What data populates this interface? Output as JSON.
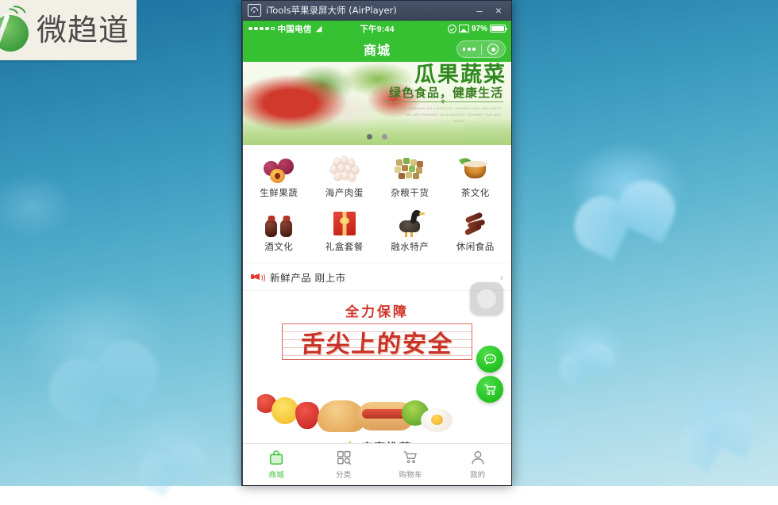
{
  "window": {
    "title": "iTools苹果录屏大师 (AirPlayer)",
    "icon": "airplay-icon",
    "minimize_label": "–",
    "close_label": "×"
  },
  "watermark": {
    "text": "微趋道",
    "icon": "wechat-signal-logo"
  },
  "status_bar": {
    "signal_dots_filled": 4,
    "signal_dots_total": 5,
    "carrier": "中国电信",
    "wifi_icon": "wifi-icon",
    "time": "下午9:44",
    "lock_icon": "rotation-lock-icon",
    "airplay_icon": "airplay-mirror-icon",
    "battery_percent": "97%",
    "battery_level": 97
  },
  "nav_bar": {
    "title": "商城",
    "capsule": {
      "menu_icon": "more-dots-icon",
      "target_icon": "target-circle-icon"
    }
  },
  "hero": {
    "headline": "瓜果蔬菜",
    "subtitle": "绿色食品，健康生活",
    "fine_line1": "WE ARE RUNNING ON A HEALTHY JOURNEY DAY AND NIGHT",
    "fine_line2": "WE ARE RUNNING ON A HEALTHY JOURNEY DAY AND",
    "fine_line3": "NIGHT",
    "dots": 2,
    "active_dot": 1
  },
  "categories": [
    {
      "label": "生鲜果蔬",
      "icon": "plum-fruit-icon"
    },
    {
      "label": "海产肉蛋",
      "icon": "eggs-icon"
    },
    {
      "label": "杂粮干货",
      "icon": "grains-icon"
    },
    {
      "label": "茶文化",
      "icon": "tea-cup-icon"
    },
    {
      "label": "酒文化",
      "icon": "wine-jar-icon"
    },
    {
      "label": "礼盒套餐",
      "icon": "gift-box-icon"
    },
    {
      "label": "融水特产",
      "icon": "duck-icon"
    },
    {
      "label": "休闲食品",
      "icon": "jerky-icon"
    }
  ],
  "announcement": {
    "icon": "megaphone-icon",
    "text": "新鲜产品 刚上市",
    "arrow": "›"
  },
  "promo": {
    "top_text": "全力保障",
    "main_text": "舌尖上的安全"
  },
  "recommend": {
    "thumb_icon": "thumbs-up-icon",
    "title": "店家推荐"
  },
  "floating": {
    "assistive_touch": "assistive-touch-button",
    "chat": "chat-bubble-button",
    "cart": "shopping-cart-button"
  },
  "tabs": [
    {
      "label": "商城",
      "icon": "shop-bag-icon",
      "active": true
    },
    {
      "label": "分类",
      "icon": "grid-search-icon",
      "active": false
    },
    {
      "label": "购物车",
      "icon": "cart-icon",
      "active": false
    },
    {
      "label": "我的",
      "icon": "person-icon",
      "active": false
    }
  ],
  "colors": {
    "brand_green": "#36c132",
    "accent_red": "#c8322b",
    "tab_active": "#3ec23a",
    "title_bar": "#3b4557"
  }
}
